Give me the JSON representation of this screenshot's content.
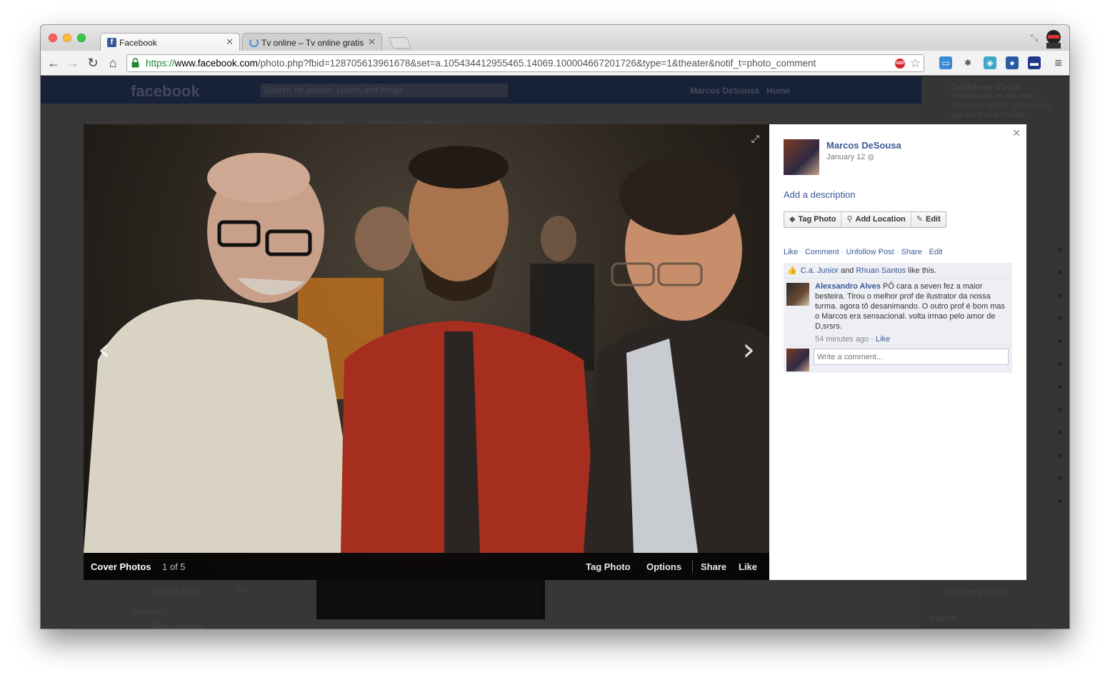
{
  "browser": {
    "tabs": [
      {
        "title": "Facebook",
        "favicon": "facebook-icon",
        "active": true
      },
      {
        "title": "Tv online – Tv online gratis",
        "favicon": "loading-spinner-icon",
        "active": false
      }
    ],
    "url": {
      "scheme": "https://",
      "host": "www.facebook.com",
      "rest": "/photo.php?fbid=128705613961678&set=a.105434412955465.14069.100004667201726&type=1&theater&notif_t=photo_comment"
    },
    "extensions": [
      "adblock-icon",
      "bookmark-star-icon",
      "screen-capture-icon",
      "bug-icon",
      "puzzle-icon",
      "user-icon",
      "flag-icon",
      "menu-icon"
    ]
  },
  "background_page": {
    "logo": "facebook",
    "search_placeholder": "Search for people, places and things",
    "user_name": "Marcos DeSousa",
    "home": "Home",
    "update_status": "Update Status",
    "add_photos": "Add Photos / Video",
    "games_feed": "Games Feed",
    "games_count": "20+",
    "interests": "INTERESTS",
    "web_content": "Web Content",
    "ticker": {
      "name": "Guilherme Vieira",
      "text": "commented on Kleriston Almeida's photo: \"Ainda bem que você ta em casa...\"",
      "bottom_name": "Alexandre Nunes",
      "search": "Search"
    }
  },
  "theater": {
    "album_name": "Cover Photos",
    "album_position": "1 of 5",
    "bar_actions": [
      "Tag Photo",
      "Options",
      "Share",
      "Like"
    ],
    "prev_icon": "chevron-left-icon",
    "next_icon": "chevron-right-icon"
  },
  "sidebar": {
    "owner_name": "Marcos DeSousa",
    "date": "January 12",
    "add_description": "Add a description",
    "buttons": [
      {
        "label": "Tag Photo",
        "icon": "tag-icon"
      },
      {
        "label": "Add Location",
        "icon": "location-pin-icon"
      },
      {
        "label": "Edit",
        "icon": "pencil-icon"
      }
    ],
    "ufi_actions": [
      "Like",
      "Comment",
      "Unfollow Post",
      "Share",
      "Edit"
    ],
    "likes": {
      "user1": "C.a. Junior",
      "and": "and",
      "user2": "Rhuan Santos",
      "suffix": "like this."
    },
    "comment": {
      "author": "Alexsandro Alves",
      "text": "PÔ cara a seven fez a maior besteira. Tirou o melhor prof de ilustrator da nossa turma. agora tô desanimando. O outro prof é bom mas o Marcos era sensacional. volta irmao pelo amor de D,srsrs.",
      "time": "54 minutes ago",
      "like": "Like"
    },
    "write_placeholder": "Write a comment..."
  },
  "colors": {
    "facebook_blue": "#3b5998",
    "link": "#3b5998",
    "ufi_bg": "#edeff4"
  }
}
